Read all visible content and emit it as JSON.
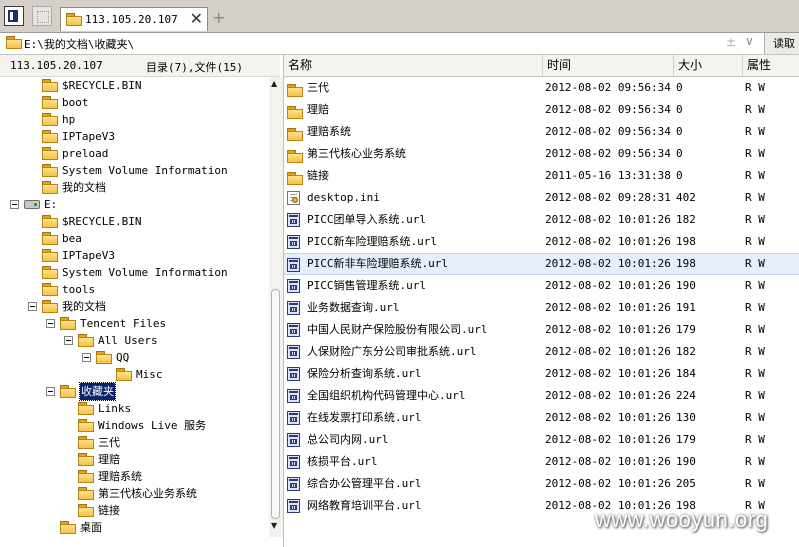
{
  "tab": {
    "title": "113.105.20.107"
  },
  "address": {
    "path": "E:\\我的文档\\收藏夹\\",
    "read_label": "读取"
  },
  "left_header": {
    "host": "113.105.20.107",
    "stats": "目录(7),文件(15)"
  },
  "tree": [
    {
      "label": "$RECYCLE.BIN",
      "kind": "folder"
    },
    {
      "label": "boot",
      "kind": "folder"
    },
    {
      "label": "hp",
      "kind": "folder"
    },
    {
      "label": "IPTapeV3",
      "kind": "folder"
    },
    {
      "label": "preload",
      "kind": "folder"
    },
    {
      "label": "System Volume Information",
      "kind": "folder"
    },
    {
      "label": "我的文档",
      "kind": "folder"
    },
    {
      "label": "E:",
      "kind": "drive"
    },
    {
      "label": "$RECYCLE.BIN",
      "kind": "folder"
    },
    {
      "label": "bea",
      "kind": "folder"
    },
    {
      "label": "IPTapeV3",
      "kind": "folder"
    },
    {
      "label": "System Volume Information",
      "kind": "folder"
    },
    {
      "label": "tools",
      "kind": "folder"
    },
    {
      "label": "我的文档",
      "kind": "folder"
    },
    {
      "label": "Tencent Files",
      "kind": "folder"
    },
    {
      "label": "All Users",
      "kind": "folder"
    },
    {
      "label": "QQ",
      "kind": "folder"
    },
    {
      "label": "Misc",
      "kind": "folder"
    },
    {
      "label": "收藏夹",
      "kind": "folder",
      "selected": true
    },
    {
      "label": "Links",
      "kind": "folder"
    },
    {
      "label": "Windows Live 服务",
      "kind": "folder"
    },
    {
      "label": "三代",
      "kind": "folder"
    },
    {
      "label": "理赔",
      "kind": "folder"
    },
    {
      "label": "理赔系统",
      "kind": "folder"
    },
    {
      "label": "第三代核心业务系统",
      "kind": "folder"
    },
    {
      "label": "链接",
      "kind": "folder"
    },
    {
      "label": "桌面",
      "kind": "folder"
    }
  ],
  "columns": {
    "name": "名称",
    "time": "时间",
    "size": "大小",
    "attr": "属性"
  },
  "files": [
    {
      "name": "三代",
      "time": "2012-08-02 09:56:34",
      "size": "0",
      "attr": "R W",
      "icon": "folder"
    },
    {
      "name": "理赔",
      "time": "2012-08-02 09:56:34",
      "size": "0",
      "attr": "R W",
      "icon": "folder"
    },
    {
      "name": "理赔系统",
      "time": "2012-08-02 09:56:34",
      "size": "0",
      "attr": "R W",
      "icon": "folder"
    },
    {
      "name": "第三代核心业务系统",
      "time": "2012-08-02 09:56:34",
      "size": "0",
      "attr": "R W",
      "icon": "folder"
    },
    {
      "name": "链接",
      "time": "2011-05-16 13:31:38",
      "size": "0",
      "attr": "R W",
      "icon": "folder"
    },
    {
      "name": "desktop.ini",
      "time": "2012-08-02 09:28:31",
      "size": "402",
      "attr": "R W",
      "icon": "ini"
    },
    {
      "name": "PICC团单导入系统.url",
      "time": "2012-08-02 10:01:26",
      "size": "182",
      "attr": "R W",
      "icon": "url"
    },
    {
      "name": "PICC新车险理赔系统.url",
      "time": "2012-08-02 10:01:26",
      "size": "198",
      "attr": "R W",
      "icon": "url"
    },
    {
      "name": "PICC新非车险理赔系统.url",
      "time": "2012-08-02 10:01:26",
      "size": "198",
      "attr": "R W",
      "icon": "url",
      "selected": true
    },
    {
      "name": "PICC销售管理系统.url",
      "time": "2012-08-02 10:01:26",
      "size": "190",
      "attr": "R W",
      "icon": "url"
    },
    {
      "name": "业务数据查询.url",
      "time": "2012-08-02 10:01:26",
      "size": "191",
      "attr": "R W",
      "icon": "url"
    },
    {
      "name": "中国人民财产保险股份有限公司.url",
      "time": "2012-08-02 10:01:26",
      "size": "179",
      "attr": "R W",
      "icon": "url"
    },
    {
      "name": "人保财险广东分公司审批系统.url",
      "time": "2012-08-02 10:01:26",
      "size": "182",
      "attr": "R W",
      "icon": "url"
    },
    {
      "name": "保险分析查询系统.url",
      "time": "2012-08-02 10:01:26",
      "size": "184",
      "attr": "R W",
      "icon": "url"
    },
    {
      "name": "全国组织机构代码管理中心.url",
      "time": "2012-08-02 10:01:26",
      "size": "224",
      "attr": "R W",
      "icon": "url"
    },
    {
      "name": "在线发票打印系统.url",
      "time": "2012-08-02 10:01:26",
      "size": "130",
      "attr": "R W",
      "icon": "url"
    },
    {
      "name": "总公司内网.url",
      "time": "2012-08-02 10:01:26",
      "size": "179",
      "attr": "R W",
      "icon": "url"
    },
    {
      "name": "核损平台.url",
      "time": "2012-08-02 10:01:26",
      "size": "190",
      "attr": "R W",
      "icon": "url"
    },
    {
      "name": "综合办公管理平台.url",
      "time": "2012-08-02 10:01:26",
      "size": "205",
      "attr": "R W",
      "icon": "url"
    },
    {
      "name": "网络教育培训平台.url",
      "time": "2012-08-02 10:01:26",
      "size": "198",
      "attr": "R W",
      "icon": "url"
    }
  ],
  "watermark": "www.wooyun.org",
  "colors": {
    "selection": "#0a246a",
    "row_highlight": "#e6eefb",
    "folder": "#f3c24b"
  }
}
